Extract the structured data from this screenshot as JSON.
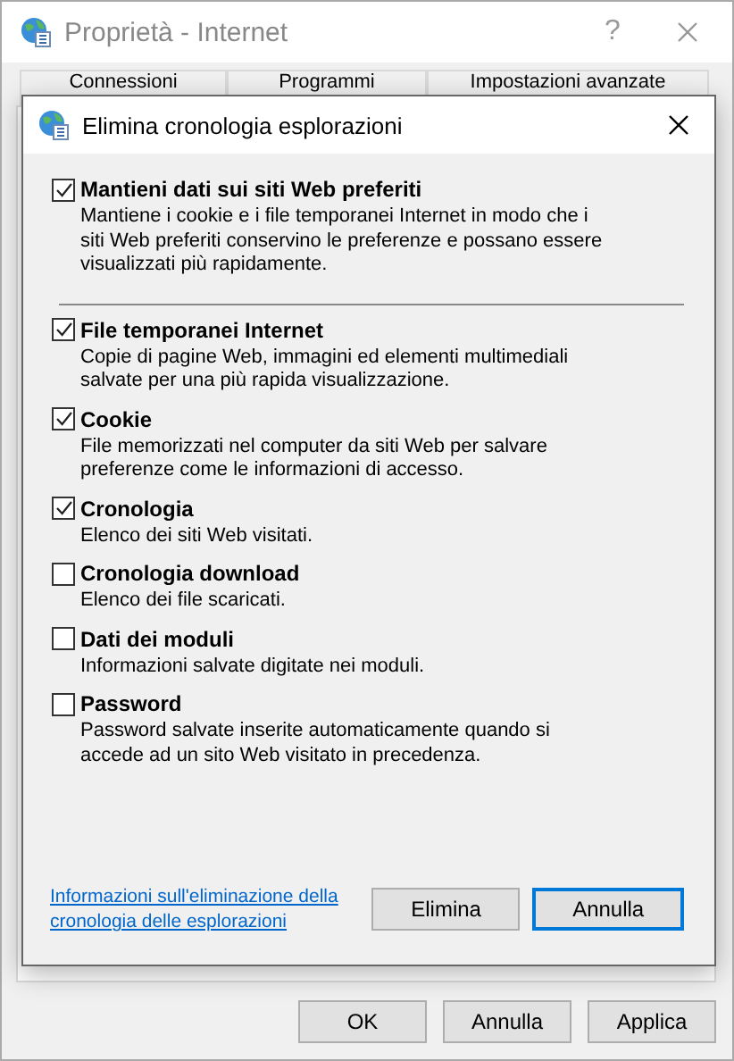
{
  "window": {
    "title": "Proprietà - Internet",
    "help": "?"
  },
  "tabs": [
    {
      "label": "Connessioni",
      "selected": false
    },
    {
      "label": "Programmi",
      "selected": false
    },
    {
      "label": "Impostazioni avanzate",
      "selected": false
    }
  ],
  "buttons": [
    {
      "label": "OK",
      "selected": false
    },
    {
      "label": "Annulla",
      "selected": false
    },
    {
      "label": "Applica",
      "selected": false
    }
  ],
  "dialog": {
    "title": "Elimina cronologia esplorazioni",
    "sections": [
      {
        "items": [
          {
            "label": "Mantieni dati sui siti Web preferiti",
            "description": "Mantiene i cookie e i file temporanei Internet in modo che i siti Web preferiti conservino le preferenze e possano essere visualizzati più rapidamente.",
            "checked": true
          }
        ]
      },
      {
        "items": [
          {
            "label": "File temporanei Internet",
            "description": "Copie di pagine Web, immagini ed elementi multimediali salvate per una più rapida visualizzazione.",
            "checked": true
          },
          {
            "label": "Cookie",
            "description": "File memorizzati nel computer da siti Web per salvare preferenze come le informazioni di accesso.",
            "checked": true
          },
          {
            "label": "Cronologia",
            "description": "Elenco dei siti Web visitati.",
            "checked": true
          },
          {
            "label": "Cronologia download",
            "description": "Elenco dei file scaricati.",
            "checked": false
          },
          {
            "label": "Dati dei moduli",
            "description": "Informazioni salvate digitate nei moduli.",
            "checked": false
          },
          {
            "label": "Password",
            "description": "Password salvate inserite automaticamente quando si accede ad un sito Web visitato in precedenza.",
            "checked": false
          }
        ]
      }
    ],
    "link": "Informazioni sull'eliminazione della cronologia delle esplorazioni",
    "buttons": [
      {
        "label": "Elimina",
        "selected": false
      },
      {
        "label": "Annulla",
        "selected": true
      }
    ]
  }
}
